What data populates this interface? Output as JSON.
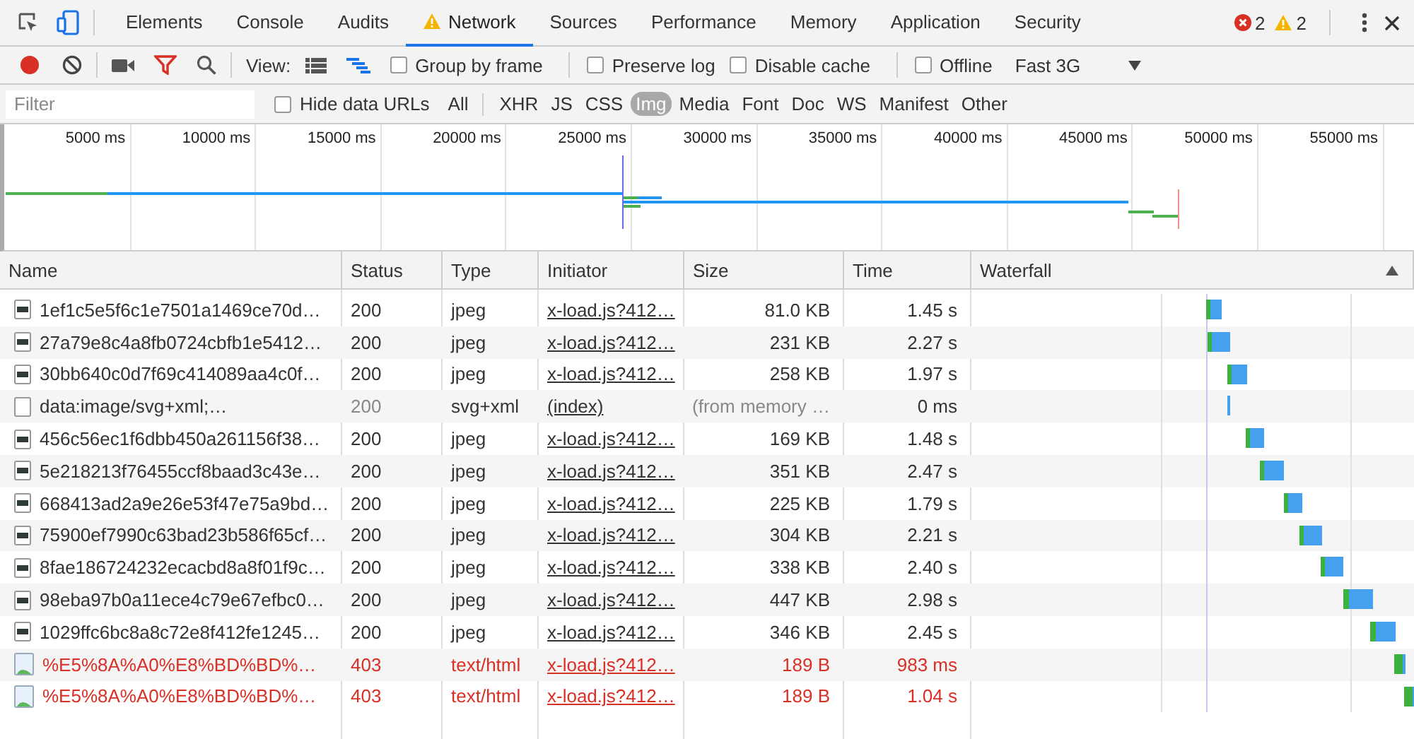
{
  "tabs": [
    {
      "label": "Elements",
      "selected": false,
      "warning": false
    },
    {
      "label": "Console",
      "selected": false,
      "warning": false
    },
    {
      "label": "Audits",
      "selected": false,
      "warning": false
    },
    {
      "label": "Network",
      "selected": true,
      "warning": true
    },
    {
      "label": "Sources",
      "selected": false,
      "warning": false
    },
    {
      "label": "Performance",
      "selected": false,
      "warning": false
    },
    {
      "label": "Memory",
      "selected": false,
      "warning": false
    },
    {
      "label": "Application",
      "selected": false,
      "warning": false
    },
    {
      "label": "Security",
      "selected": false,
      "warning": false
    }
  ],
  "counts": {
    "errors": "2",
    "warnings": "2"
  },
  "toolbar": {
    "recording": true,
    "view_label": "View:",
    "options": [
      {
        "label": "Group by frame",
        "checked": false
      },
      {
        "label": "Preserve log",
        "checked": false
      },
      {
        "label": "Disable cache",
        "checked": false
      },
      {
        "label": "Offline",
        "checked": false
      }
    ],
    "throttling": "Fast 3G"
  },
  "filter": {
    "placeholder": "Filter",
    "hide_data_urls": {
      "label": "Hide data URLs",
      "checked": false
    },
    "types": [
      {
        "label": "All",
        "selected": false
      },
      {
        "label": "XHR",
        "selected": false
      },
      {
        "label": "JS",
        "selected": false
      },
      {
        "label": "CSS",
        "selected": false
      },
      {
        "label": "Img",
        "selected": true
      },
      {
        "label": "Media",
        "selected": false
      },
      {
        "label": "Font",
        "selected": false
      },
      {
        "label": "Doc",
        "selected": false
      },
      {
        "label": "WS",
        "selected": false
      },
      {
        "label": "Manifest",
        "selected": false
      },
      {
        "label": "Other",
        "selected": false
      }
    ]
  },
  "overview": {
    "ticks": [
      "5000 ms",
      "10000 ms",
      "15000 ms",
      "20000 ms",
      "25000 ms",
      "30000 ms",
      "35000 ms",
      "40000 ms",
      "45000 ms",
      "50000 ms",
      "55000 ms"
    ]
  },
  "table": {
    "columns": [
      "Name",
      "Status",
      "Type",
      "Initiator",
      "Size",
      "Time",
      "Waterfall"
    ],
    "sort_ascending": true,
    "rows": [
      {
        "kind": "image",
        "name": "1ef1c5e5f6c1e7501a1469ce70d…",
        "status": "200",
        "type": "jpeg",
        "initiator": "x-load.js?412…",
        "size": "81.0 KB",
        "time": "1.45 s"
      },
      {
        "kind": "image",
        "name": "27a79e8c4a8fb0724cbfb1e5412…",
        "status": "200",
        "type": "jpeg",
        "initiator": "x-load.js?412…",
        "size": "231 KB",
        "time": "2.27 s"
      },
      {
        "kind": "image",
        "name": "30bb640c0d7f69c414089aa4c0f…",
        "status": "200",
        "type": "jpeg",
        "initiator": "x-load.js?412…",
        "size": "258 KB",
        "time": "1.97 s"
      },
      {
        "kind": "data",
        "name": "data:image/svg+xml;…",
        "status": "200",
        "type": "svg+xml",
        "initiator": "(index)",
        "size": "(from memory …",
        "time": "0 ms"
      },
      {
        "kind": "image",
        "name": "456c56ec1f6dbb450a261156f38…",
        "status": "200",
        "type": "jpeg",
        "initiator": "x-load.js?412…",
        "size": "169 KB",
        "time": "1.48 s"
      },
      {
        "kind": "image",
        "name": "5e218213f76455ccf8baad3c43e…",
        "status": "200",
        "type": "jpeg",
        "initiator": "x-load.js?412…",
        "size": "351 KB",
        "time": "2.47 s"
      },
      {
        "kind": "image",
        "name": "668413ad2a9e26e53f47e75a9bd…",
        "status": "200",
        "type": "jpeg",
        "initiator": "x-load.js?412…",
        "size": "225 KB",
        "time": "1.79 s"
      },
      {
        "kind": "image",
        "name": "75900ef7990c63bad23b586f65cf…",
        "status": "200",
        "type": "jpeg",
        "initiator": "x-load.js?412…",
        "size": "304 KB",
        "time": "2.21 s"
      },
      {
        "kind": "image",
        "name": "8fae186724232ecacbd8a8f01f9c…",
        "status": "200",
        "type": "jpeg",
        "initiator": "x-load.js?412…",
        "size": "338 KB",
        "time": "2.40 s"
      },
      {
        "kind": "image",
        "name": "98eba97b0a11ece4c79e67efbc0…",
        "status": "200",
        "type": "jpeg",
        "initiator": "x-load.js?412…",
        "size": "447 KB",
        "time": "2.98 s"
      },
      {
        "kind": "image",
        "name": "1029ffc6bc8a8c72e8f412fe1245…",
        "status": "200",
        "type": "jpeg",
        "initiator": "x-load.js?412…",
        "size": "346 KB",
        "time": "2.45 s"
      },
      {
        "kind": "error",
        "name": "%E5%8A%A0%E8%BD%BD%…",
        "status": "403",
        "type": "text/html",
        "initiator": "x-load.js?412…",
        "size": "189 B",
        "time": "983 ms"
      },
      {
        "kind": "error",
        "name": "%E5%8A%A0%E8%BD%BD%…",
        "status": "403",
        "type": "text/html",
        "initiator": "x-load.js?412…",
        "size": "189 B",
        "time": "1.04 s"
      }
    ]
  }
}
